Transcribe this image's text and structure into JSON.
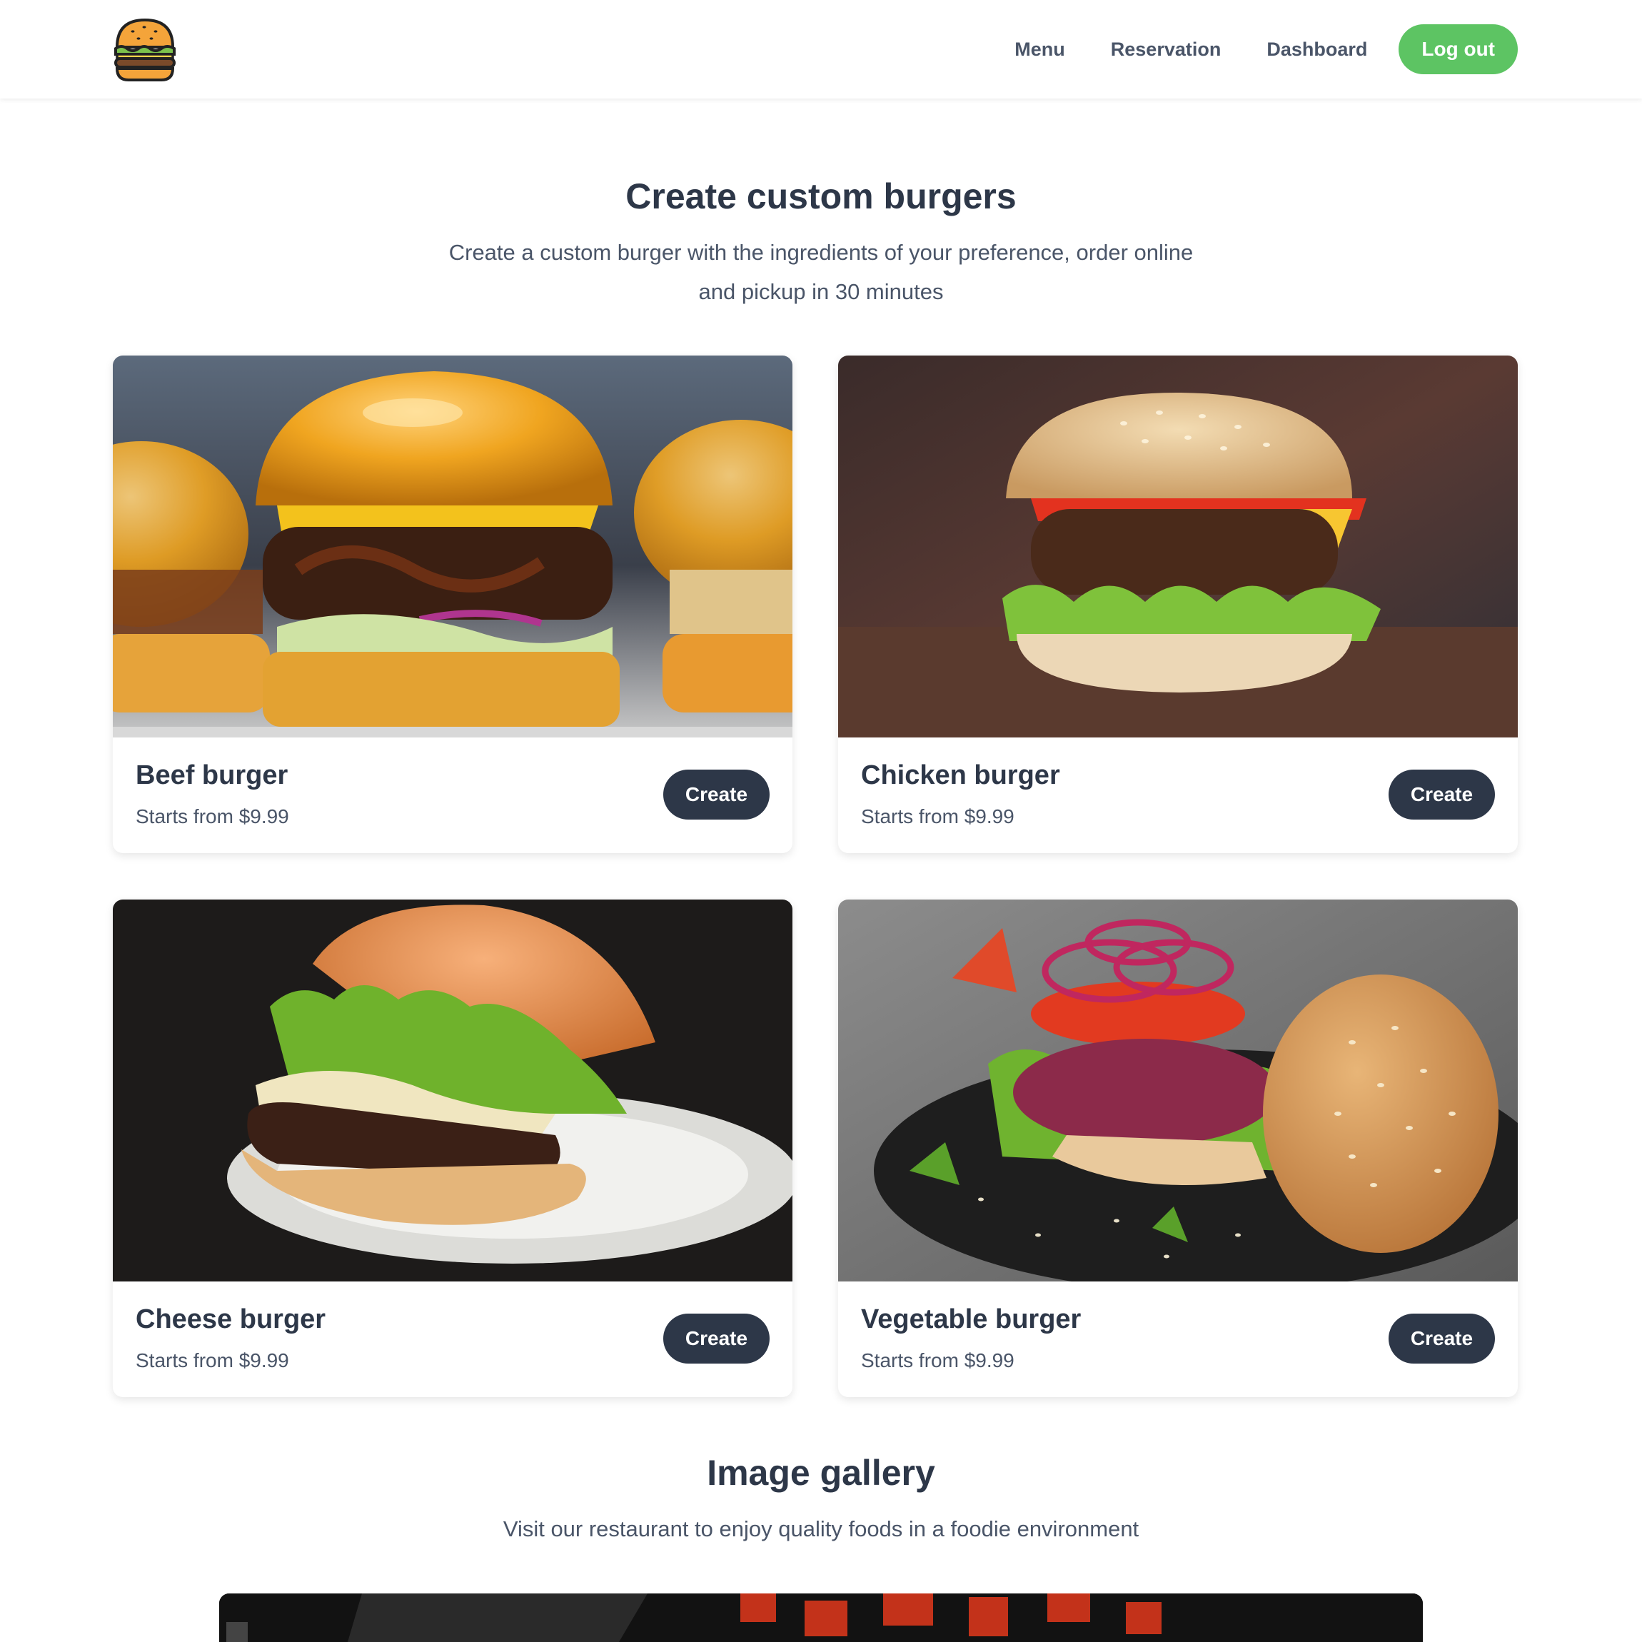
{
  "header": {
    "logo": "burger-logo",
    "nav": [
      {
        "label": "Menu"
      },
      {
        "label": "Reservation"
      },
      {
        "label": "Dashboard"
      }
    ],
    "logout_label": "Log out",
    "accent_color": "#5dc463"
  },
  "hero": {
    "title": "Create custom burgers",
    "subtitle": "Create a custom burger with the ingredients of your preference, order online and pickup in 30 minutes"
  },
  "cards": [
    {
      "name": "Beef burger",
      "price": "Starts from $9.99",
      "button": "Create",
      "image": "beef-burger-photo"
    },
    {
      "name": "Chicken burger",
      "price": "Starts from $9.99",
      "button": "Create",
      "image": "chicken-burger-photo"
    },
    {
      "name": "Cheese burger",
      "price": "Starts from $9.99",
      "button": "Create",
      "image": "cheese-burger-photo"
    },
    {
      "name": "Vegetable burger",
      "price": "Starts from $9.99",
      "button": "Create",
      "image": "vegetable-burger-photo"
    }
  ],
  "gallery": {
    "title": "Image gallery",
    "subtitle": "Visit our restaurant to enjoy quality foods in a foodie environment",
    "image": "restaurant-interior-photo"
  },
  "colors": {
    "dark_button": "#2d3748",
    "heading": "#2d3748",
    "body_text": "#4a5568"
  }
}
